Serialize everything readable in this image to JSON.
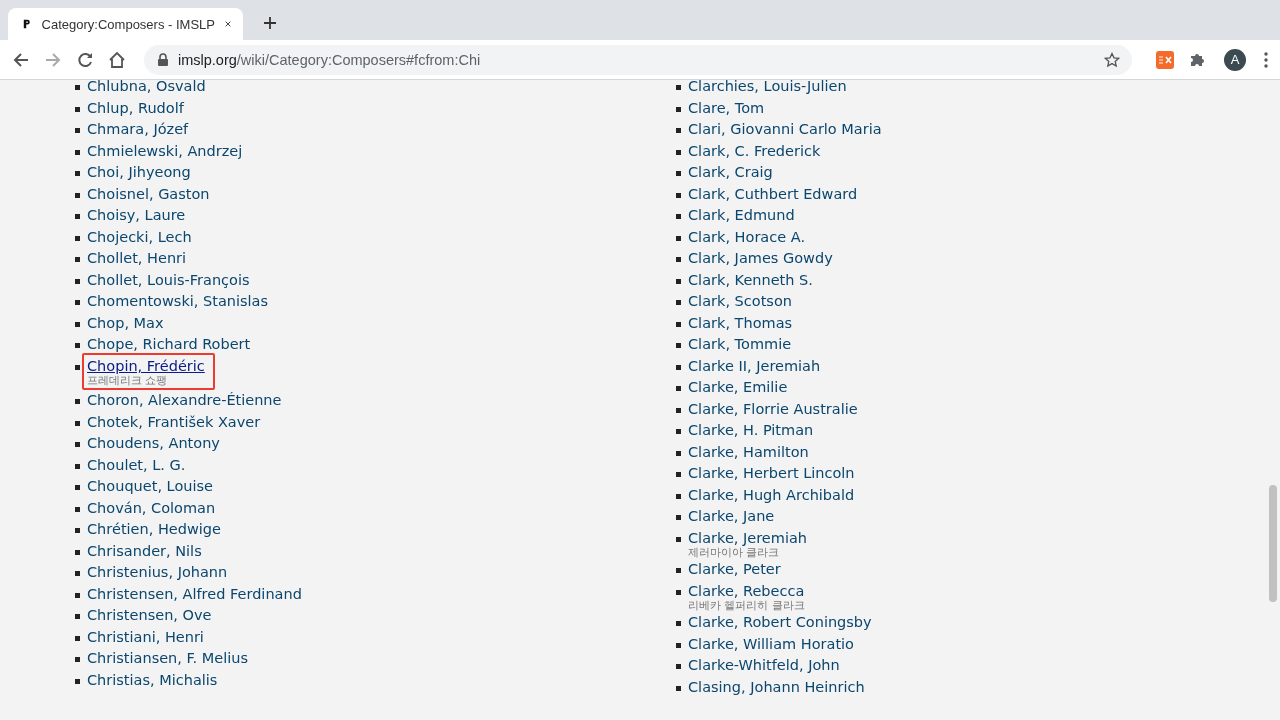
{
  "browser": {
    "tab": {
      "title": "Category:Composers - IMSLP"
    },
    "address": {
      "domain": "imslp.org",
      "path": "/wiki/Category:Composers#fcfrom:Chi"
    },
    "profile_initial": "A"
  },
  "columns": [
    {
      "items": [
        {
          "name": "Chlubna, Osvald",
          "highlighted": false
        },
        {
          "name": "Chlup, Rudolf",
          "highlighted": false
        },
        {
          "name": "Chmara, Józef",
          "highlighted": false
        },
        {
          "name": "Chmielewski, Andrzej",
          "highlighted": false
        },
        {
          "name": "Choi, Jihyeong",
          "highlighted": false
        },
        {
          "name": "Choisnel, Gaston",
          "highlighted": false
        },
        {
          "name": "Choisy, Laure",
          "highlighted": false
        },
        {
          "name": "Chojecki, Lech",
          "highlighted": false
        },
        {
          "name": "Chollet, Henri",
          "highlighted": false
        },
        {
          "name": "Chollet, Louis-François",
          "highlighted": false
        },
        {
          "name": "Chomentowski, Stanislas",
          "highlighted": false
        },
        {
          "name": "Chop, Max",
          "highlighted": false
        },
        {
          "name": "Chope, Richard Robert",
          "highlighted": false
        },
        {
          "name": "Chopin, Frédéric",
          "subtitle": "프레데리크 쇼팽",
          "highlighted": true
        },
        {
          "name": "Choron, Alexandre-Étienne",
          "highlighted": false
        },
        {
          "name": "Chotek, František Xaver",
          "highlighted": false
        },
        {
          "name": "Choudens, Antony",
          "highlighted": false
        },
        {
          "name": "Choulet, L. G.",
          "highlighted": false
        },
        {
          "name": "Chouquet, Louise",
          "highlighted": false
        },
        {
          "name": "Chován, Coloman",
          "highlighted": false
        },
        {
          "name": "Chrétien, Hedwige",
          "highlighted": false
        },
        {
          "name": "Chrisander, Nils",
          "highlighted": false
        },
        {
          "name": "Christenius, Johann",
          "highlighted": false
        },
        {
          "name": "Christensen, Alfred Ferdinand",
          "highlighted": false
        },
        {
          "name": "Christensen, Ove",
          "highlighted": false
        },
        {
          "name": "Christiani, Henri",
          "highlighted": false
        },
        {
          "name": "Christiansen, F. Melius",
          "highlighted": false
        },
        {
          "name": "Christias, Michalis",
          "highlighted": false
        }
      ]
    },
    {
      "items": [
        {
          "name": "Clarchies, Louis-Julien",
          "highlighted": false
        },
        {
          "name": "Clare, Tom",
          "highlighted": false
        },
        {
          "name": "Clari, Giovanni Carlo Maria",
          "highlighted": false
        },
        {
          "name": "Clark, C. Frederick",
          "highlighted": false
        },
        {
          "name": "Clark, Craig",
          "highlighted": false
        },
        {
          "name": "Clark, Cuthbert Edward",
          "highlighted": false
        },
        {
          "name": "Clark, Edmund",
          "highlighted": false
        },
        {
          "name": "Clark, Horace A.",
          "highlighted": false
        },
        {
          "name": "Clark, James Gowdy",
          "highlighted": false
        },
        {
          "name": "Clark, Kenneth S.",
          "highlighted": false
        },
        {
          "name": "Clark, Scotson",
          "highlighted": false
        },
        {
          "name": "Clark, Thomas",
          "highlighted": false
        },
        {
          "name": "Clark, Tommie",
          "highlighted": false
        },
        {
          "name": "Clarke II, Jeremiah",
          "highlighted": false
        },
        {
          "name": "Clarke, Emilie",
          "highlighted": false
        },
        {
          "name": "Clarke, Florrie Australie",
          "highlighted": false
        },
        {
          "name": "Clarke, H. Pitman",
          "highlighted": false
        },
        {
          "name": "Clarke, Hamilton",
          "highlighted": false
        },
        {
          "name": "Clarke, Herbert Lincoln",
          "highlighted": false
        },
        {
          "name": "Clarke, Hugh Archibald",
          "highlighted": false
        },
        {
          "name": "Clarke, Jane",
          "highlighted": false
        },
        {
          "name": "Clarke, Jeremiah",
          "subtitle": "제러마이아 클라크",
          "highlighted": false
        },
        {
          "name": "Clarke, Peter",
          "highlighted": false
        },
        {
          "name": "Clarke, Rebecca",
          "subtitle": "리베카 헬퍼리히 클라크",
          "highlighted": false
        },
        {
          "name": "Clarke, Robert Coningsby",
          "highlighted": false
        },
        {
          "name": "Clarke, William Horatio",
          "highlighted": false
        },
        {
          "name": "Clarke-Whitfeld, John",
          "highlighted": false
        },
        {
          "name": "Clasing, Johann Heinrich",
          "highlighted": false
        }
      ]
    }
  ]
}
